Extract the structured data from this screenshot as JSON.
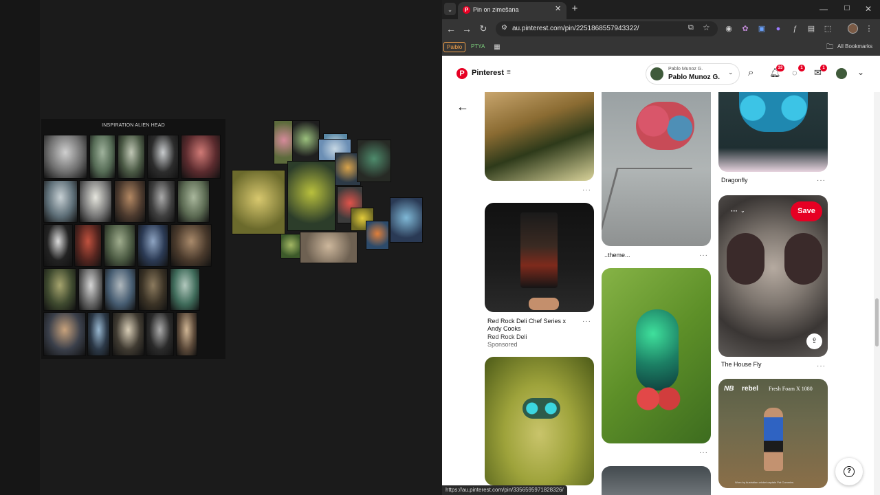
{
  "board": {
    "title": "INSPIRATION ALIEN HEAD"
  },
  "browser": {
    "tab_title": "Pin on zimešana",
    "url": "au.pinterest.com/pin/2251868557943322/",
    "new_tab": "+",
    "bookmarks": [
      {
        "label": "Paiblo"
      },
      {
        "label": "PTYA"
      }
    ],
    "all_bookmarks": "All Bookmarks",
    "status_url": "https://au.pinterest.com/pin/3356595971828326/"
  },
  "pinterest": {
    "logo_text": "Pinterest",
    "account_small": "Pablo Munoz G.",
    "account_name": "Pablo Munoz G.",
    "notif_count": "33",
    "msg_count": "1",
    "updates_count": "1",
    "help": "?"
  },
  "pins": {
    "col1": [
      {
        "caption": "",
        "more": "···"
      },
      {
        "caption": "Red Rock Deli Chef Series x Andy Cooks",
        "source": "Red Rock Deli",
        "tag": "Sponsored",
        "more": "···"
      },
      {
        "caption": "",
        "more": ""
      }
    ],
    "col2": [
      {
        "caption": "..theme...",
        "more": "···"
      },
      {
        "caption": "",
        "more": "···"
      }
    ],
    "col3": [
      {
        "caption": "Dragonfly",
        "more": "···"
      },
      {
        "caption": "The House Fly",
        "more": "···",
        "save_label": "Save",
        "board_menu": "···"
      },
      {
        "caption": "",
        "brand": "rebel",
        "ad_title": "Fresh Foam X 1080",
        "ad_note": "Worn by Australian cricket captain Pat Cummins"
      }
    ]
  },
  "colors": {
    "pinterest_red": "#e60023",
    "browser_dark": "#1f1f1f",
    "toolbar": "#353535"
  }
}
